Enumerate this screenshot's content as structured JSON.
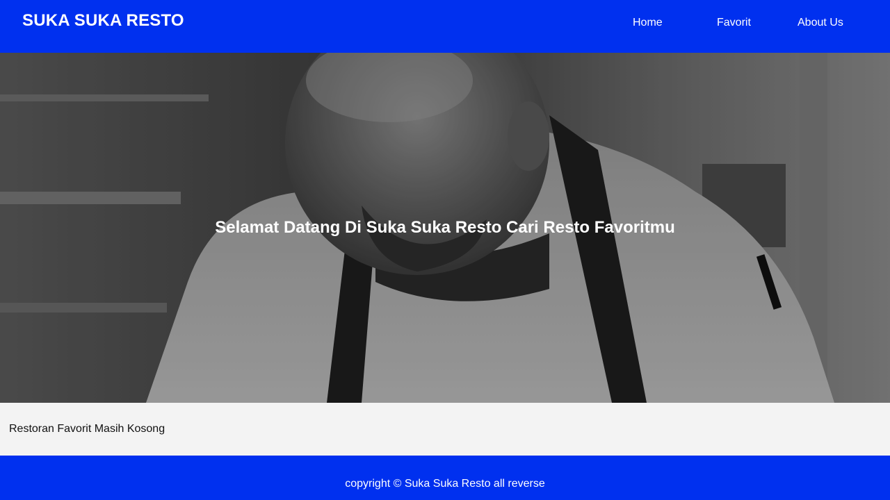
{
  "header": {
    "brand": "SUKA SUKA RESTO",
    "nav": [
      {
        "label": "Home"
      },
      {
        "label": "Favorit"
      },
      {
        "label": "About Us"
      }
    ],
    "background_color": "#0030ef"
  },
  "hero": {
    "title": "Selamat Datang Di Suka Suka Resto Cari Resto Favoritmu",
    "image_description_icon": "chef-photo"
  },
  "main": {
    "empty_message": "Restoran Favorit Masih Kosong"
  },
  "footer": {
    "text": "copyright © Suka Suka Resto all reverse",
    "background_color": "#0030ef"
  }
}
